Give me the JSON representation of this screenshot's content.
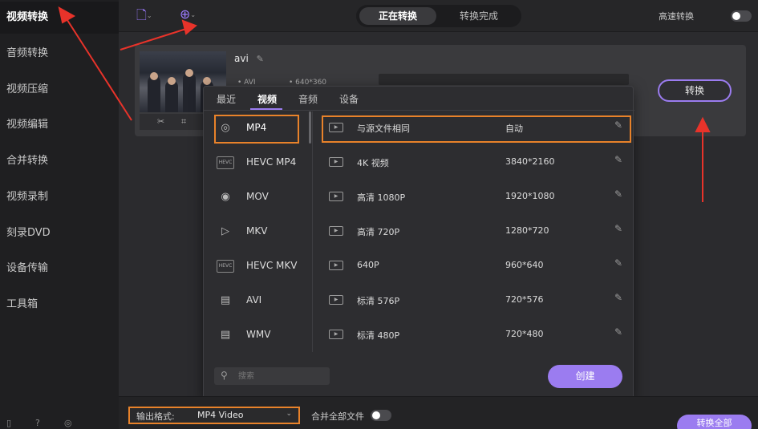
{
  "sidebar": {
    "items": [
      {
        "label": "视频转换",
        "active": true
      },
      {
        "label": "音频转换"
      },
      {
        "label": "视频压缩"
      },
      {
        "label": "视频编辑"
      },
      {
        "label": "合并转换"
      },
      {
        "label": "视频录制"
      },
      {
        "label": "刻录DVD"
      },
      {
        "label": "设备传输"
      },
      {
        "label": "工具箱"
      }
    ],
    "bottom_icons": [
      "book-icon",
      "help-icon",
      "user-icon"
    ]
  },
  "topbar": {
    "add_file_icon": "add-file-icon",
    "add_disc_icon": "add-disc-icon",
    "tabs": [
      "正在转换",
      "转换完成"
    ],
    "fast_label": "高速转换"
  },
  "file": {
    "name": "avi",
    "format": "AVI",
    "resolution": "640*360",
    "convert_label": "转换"
  },
  "popup": {
    "tabs": [
      "最近",
      "视频",
      "音频",
      "设备"
    ],
    "active_tab": "视频",
    "formats": [
      "MP4",
      "HEVC MP4",
      "MOV",
      "MKV",
      "HEVC MKV",
      "AVI",
      "WMV"
    ],
    "selected_format": "MP4",
    "presets": [
      {
        "name": "与源文件相同",
        "size": "自动"
      },
      {
        "name": "4K 视频",
        "size": "3840*2160"
      },
      {
        "name": "高清 1080P",
        "size": "1920*1080"
      },
      {
        "name": "高清 720P",
        "size": "1280*720"
      },
      {
        "name": "640P",
        "size": "960*640"
      },
      {
        "name": "标清 576P",
        "size": "720*576"
      },
      {
        "name": "标清 480P",
        "size": "720*480"
      }
    ],
    "search_placeholder": "搜索",
    "create_label": "创建"
  },
  "bottombar": {
    "output_label": "输出格式:",
    "output_value": "MP4 Video",
    "merge_label": "合并全部文件",
    "convert_all_label": "转换全部"
  },
  "colors": {
    "accent": "#9b7cf0",
    "highlight": "#e8822a",
    "annotation": "#e8332a"
  }
}
